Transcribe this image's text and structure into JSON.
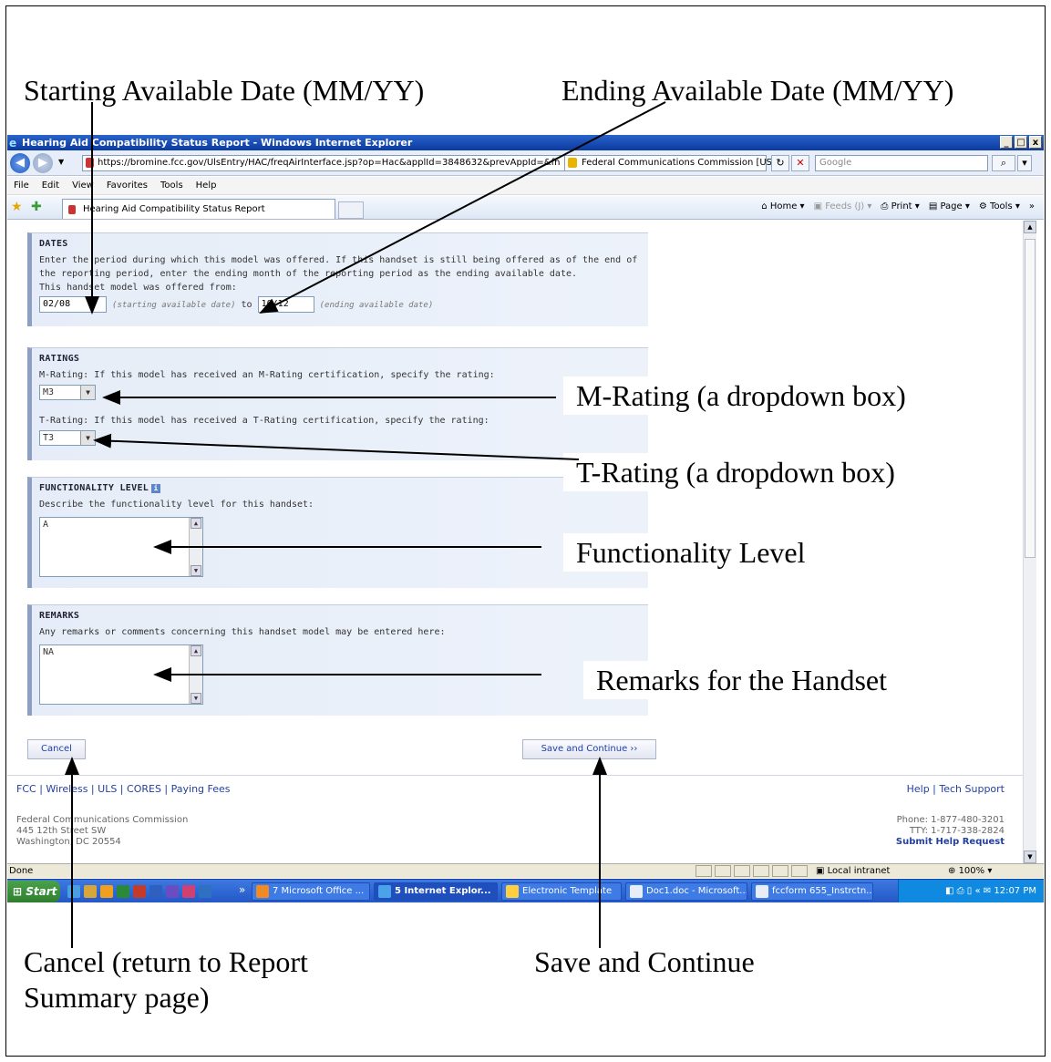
{
  "annotations": {
    "starting_date": "Starting Available Date (MM/YY)",
    "ending_date": "Ending Available Date (MM/YY)",
    "m_rating": "M-Rating (a dropdown box)",
    "t_rating": "T-Rating (a dropdown box)",
    "functionality": "Functionality Level",
    "remarks": "Remarks for the Handset",
    "cancel_line1": "Cancel (return to Report",
    "cancel_line2": "Summary page)",
    "save": "Save and Continue"
  },
  "browser": {
    "title": "Hearing Aid Compatibility Status Report - Windows Internet Explorer",
    "url": "https://bromine.fcc.gov/UlsEntry/HAC/freqAirInterface.jsp?op=Hac&applId=3848632&prevAppId=&fn",
    "cert": "Federal Communications Commission [US]",
    "search_placeholder": "Google",
    "menu": [
      "File",
      "Edit",
      "View",
      "Favorites",
      "Tools",
      "Help"
    ],
    "tab_title": "Hearing Aid Compatibility Status Report",
    "commands": {
      "home": "Home",
      "feeds": "Feeds (J)",
      "print": "Print",
      "page": "Page",
      "tools": "Tools"
    }
  },
  "dates": {
    "heading": "DATES",
    "instructions": "Enter the period during which this model was offered. If this handset is still being offered as of the end of the reporting period, enter the ending month of the reporting period as the ending available date.",
    "offered_from": "This handset model was offered from:",
    "start_value": "02/08",
    "start_hint": "(starting available date)",
    "to": "to",
    "end_value": "10/12",
    "end_hint": "(ending available date)"
  },
  "ratings": {
    "heading": "RATINGS",
    "m_label": "M-Rating: If this model has received an M-Rating certification, specify the rating:",
    "m_value": "M3",
    "t_label": "T-Rating: If this model has received a T-Rating certification, specify the rating:",
    "t_value": "T3"
  },
  "functionality": {
    "heading": "FUNCTIONALITY LEVEL",
    "label": "Describe the functionality level for this handset:",
    "value": "A"
  },
  "remarks": {
    "heading": "REMARKS",
    "label": "Any remarks or comments concerning this handset model may be entered here:",
    "value": "NA"
  },
  "buttons": {
    "cancel": "Cancel",
    "save": "Save and Continue ››"
  },
  "footer": {
    "links": [
      "FCC",
      "Wireless",
      "ULS",
      "CORES",
      "Paying Fees"
    ],
    "right_links": [
      "Help",
      "Tech Support"
    ],
    "address": [
      "Federal Communications Commission",
      "445 12th Street SW",
      "Washington, DC 20554"
    ],
    "phone": "Phone: 1-877-480-3201",
    "tty": "TTY: 1-717-338-2824",
    "submit": "Submit Help Request"
  },
  "status": {
    "text": "Done",
    "zone": "Local intranet",
    "zoom": "100%"
  },
  "taskbar": {
    "start": "Start",
    "tasks": [
      "7 Microsoft Office ...",
      "5 Internet Explor...",
      "Electronic Template",
      "Doc1.doc - Microsoft...",
      "fccform 655_Instrctn..."
    ],
    "clock": "12:07 PM"
  }
}
